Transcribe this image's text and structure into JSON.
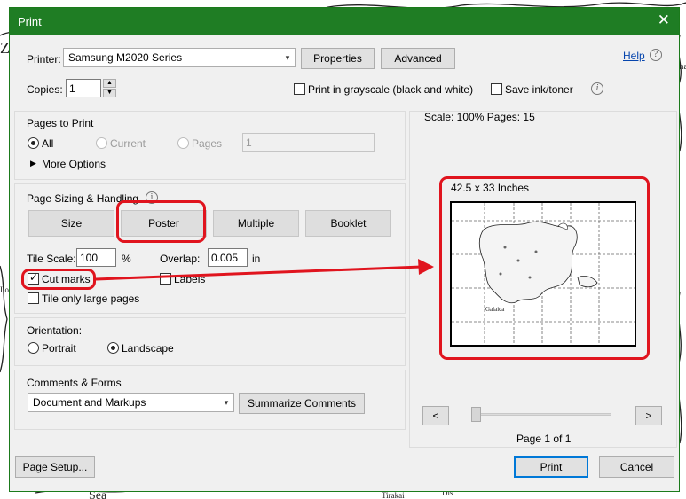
{
  "window": {
    "title": "Print",
    "close_glyph": "✕"
  },
  "printer": {
    "label": "Printer:",
    "value": "Samsung M2020 Series",
    "properties": "Properties",
    "advanced": "Advanced",
    "help": "Help"
  },
  "copies": {
    "label": "Copies:",
    "value": "1",
    "grayscale": "Print in grayscale (black and white)",
    "save_ink": "Save ink/toner"
  },
  "pages_to_print": {
    "title": "Pages to Print",
    "all": "All",
    "current": "Current",
    "pages": "Pages",
    "pages_value": "1",
    "more_options": "More Options"
  },
  "sizing": {
    "title": "Page Sizing & Handling",
    "size": "Size",
    "poster": "Poster",
    "multiple": "Multiple",
    "booklet": "Booklet",
    "tile_scale_label": "Tile Scale:",
    "tile_scale_value": "100",
    "percent": "%",
    "overlap_label": "Overlap:",
    "overlap_value": "0.005",
    "overlap_unit": "in",
    "cut_marks": "Cut marks",
    "labels": "Labels",
    "tile_large": "Tile only large pages"
  },
  "orientation": {
    "title": "Orientation:",
    "portrait": "Portrait",
    "landscape": "Landscape"
  },
  "comments": {
    "title": "Comments & Forms",
    "value": "Document and Markups",
    "summarize": "Summarize Comments"
  },
  "preview": {
    "scale_text": "Scale: 100% Pages: 15",
    "size_text": "42.5 x 33 Inches",
    "page_text": "Page 1 of 1",
    "prev": "<",
    "next": ">",
    "map_label": "Galaica",
    "slider_value": 0
  },
  "footer": {
    "page_setup": "Page Setup...",
    "print": "Print",
    "cancel": "Cancel"
  },
  "background": {
    "texts": [
      "Z",
      "Lo",
      "ina",
      "Sea",
      "Tirakai",
      "Dis"
    ]
  },
  "colors": {
    "titlebar": "#1f7d24",
    "annotation": "#e0141e",
    "primary_border": "#0078d7",
    "help_link": "#0645ad"
  }
}
